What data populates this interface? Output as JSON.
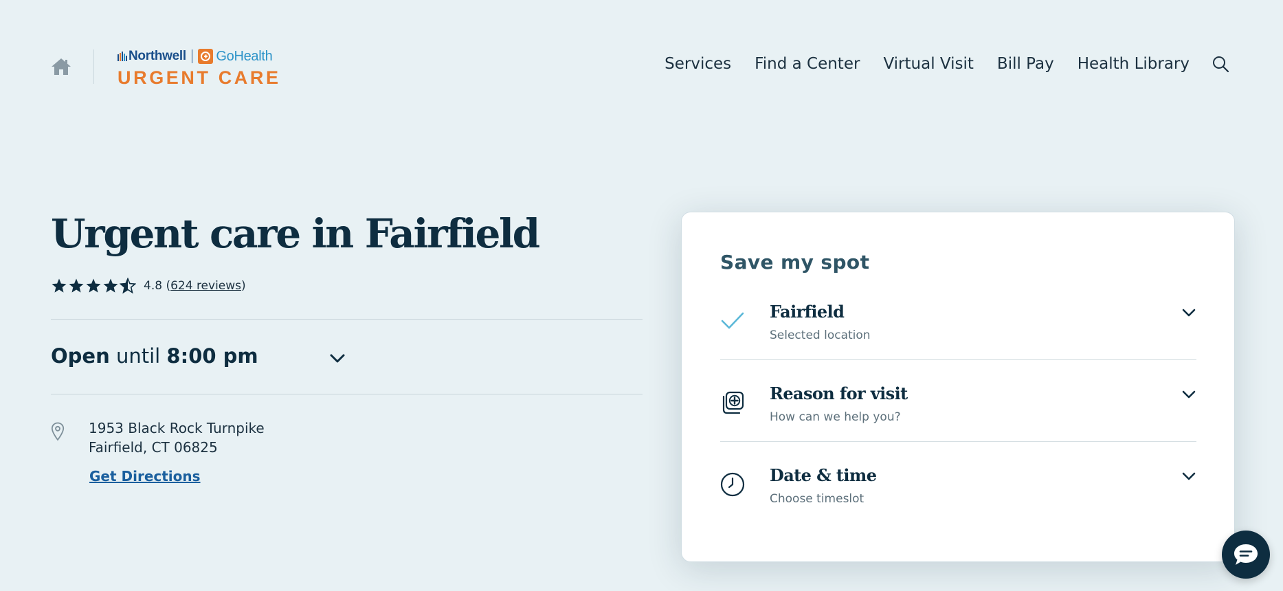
{
  "header": {
    "logo": {
      "brand_primary": "Northwell",
      "brand_secondary": "GoHealth",
      "tagline": "URGENT CARE"
    },
    "nav": [
      {
        "label": "Services"
      },
      {
        "label": "Find a Center"
      },
      {
        "label": "Virtual Visit"
      },
      {
        "label": "Bill Pay"
      },
      {
        "label": "Health Library"
      }
    ],
    "icons": {
      "home": "home-icon",
      "search": "search-icon"
    }
  },
  "hero": {
    "title": "Urgent care in Fairfield",
    "rating": {
      "stars": 4.5,
      "value": "4.8",
      "paren_open": " (",
      "reviews_label": "624 reviews",
      "paren_close": ")"
    },
    "hours": {
      "status": "Open",
      "connector": "until",
      "time": "8:00 pm"
    },
    "address": {
      "line1": "1953 Black Rock Turnpike",
      "line2": "Fairfield, CT 06825"
    },
    "directions_label": "Get Directions"
  },
  "card": {
    "title": "Save my spot",
    "steps": [
      {
        "title": "Fairfield",
        "subtitle": "Selected location",
        "icon": "check-icon"
      },
      {
        "title": "Reason for visit",
        "subtitle": "How can we help you?",
        "icon": "medical-plus-icon"
      },
      {
        "title": "Date & time",
        "subtitle": "Choose timeslot",
        "icon": "clock-icon"
      }
    ]
  },
  "colors": {
    "background": "#e8f1f4",
    "text_dark": "#0e2d40",
    "brand_orange": "#e87b2d",
    "brand_blue": "#1a4f8b",
    "gohealth_blue": "#2d93c8",
    "link": "#1a5f9e",
    "check": "#5bb8d8"
  }
}
